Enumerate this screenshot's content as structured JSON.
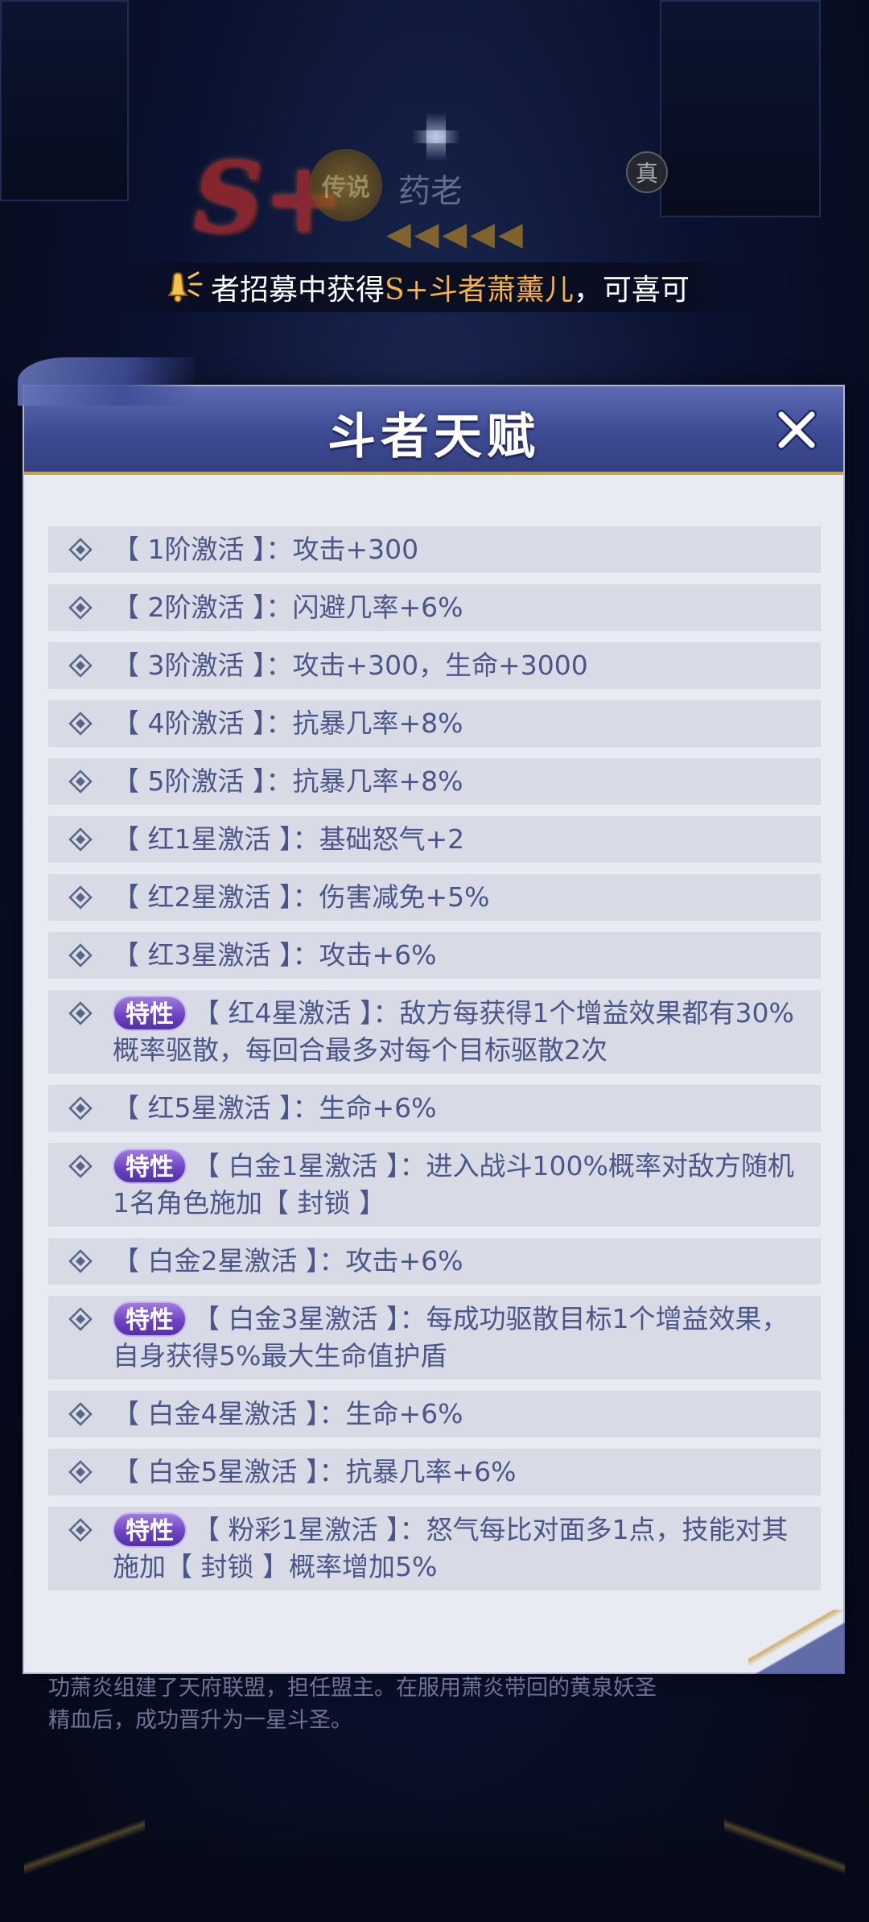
{
  "background": {
    "rank_label": "S+",
    "quality_badge": "传说",
    "hero_name": "药老",
    "stars_glyph": "◀◀◀◀◀",
    "true_badge": "真"
  },
  "marquee": {
    "icon": "bell-icon",
    "text_before": "者招募中获得",
    "text_highlight": "S+斗者萧薰儿",
    "text_after": "，可喜可"
  },
  "dialog": {
    "title": "斗者天赋",
    "close_icon": "close-icon",
    "trait_label": "特性",
    "rows": [
      {
        "trait": false,
        "text": "【 1阶激活 】：攻击+300"
      },
      {
        "trait": false,
        "text": "【 2阶激活 】：闪避几率+6%"
      },
      {
        "trait": false,
        "text": "【 3阶激活 】：攻击+300，生命+3000"
      },
      {
        "trait": false,
        "text": "【 4阶激活 】：抗暴几率+8%"
      },
      {
        "trait": false,
        "text": "【 5阶激活 】：抗暴几率+8%"
      },
      {
        "trait": false,
        "text": "【 红1星激活 】：基础怒气+2"
      },
      {
        "trait": false,
        "text": "【 红2星激活 】：伤害减免+5%"
      },
      {
        "trait": false,
        "text": "【 红3星激活 】：攻击+6%"
      },
      {
        "trait": true,
        "text": "【 红4星激活 】：敌方每获得1个增益效果都有30%概率驱散，每回合最多对每个目标驱散2次"
      },
      {
        "trait": false,
        "text": "【 红5星激活 】：生命+6%"
      },
      {
        "trait": true,
        "text": "【 白金1星激活 】：进入战斗100%概率对敌方随机1名角色施加【 封锁 】"
      },
      {
        "trait": false,
        "text": "【 白金2星激活 】：攻击+6%"
      },
      {
        "trait": true,
        "text": "【 白金3星激活 】：每成功驱散目标1个增益效果，自身获得5%最大生命值护盾"
      },
      {
        "trait": false,
        "text": "【 白金4星激活 】：生命+6%"
      },
      {
        "trait": false,
        "text": "【 白金5星激活 】：抗暴几率+6%"
      },
      {
        "trait": true,
        "text": "【 粉彩1星激活 】：怒气每比对面多1点，技能对其施加【 封锁 】概率增加5%"
      }
    ]
  },
  "story": {
    "line1": "功萧炎组建了天府联盟，担任盟主。在服用萧炎带回的黄泉妖圣",
    "line2": "精血后，成功晋升为一星斗圣。"
  },
  "colors": {
    "row_bg": "#d8dbe6",
    "row_text": "#4a5687",
    "header": "#3e4b95",
    "highlight": "#f7b14a",
    "trait_badge": "#6d44c2"
  }
}
